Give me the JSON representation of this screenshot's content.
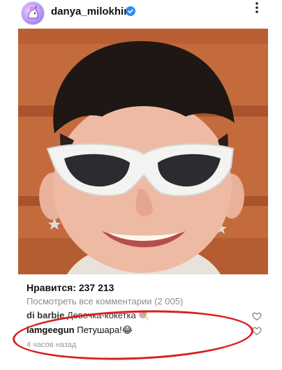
{
  "header": {
    "username": "danya_milokhin",
    "more_icon": "ellipsis-vertical-icon"
  },
  "post": {
    "likes_text": "Нравится: 237 213",
    "view_comments_text": "Посмотреть все комментарии (2 005)",
    "comments": [
      {
        "user": "di barbie",
        "text": "Девочка-кокетка 🍭"
      },
      {
        "user": "iamgeegun",
        "text": "Петушара!😂"
      }
    ],
    "time_text": "4 часов назад"
  },
  "colors": {
    "verified": "#2d8cf0",
    "annotation_circle": "#d91f1f",
    "muted_text": "#8e8e8e"
  }
}
